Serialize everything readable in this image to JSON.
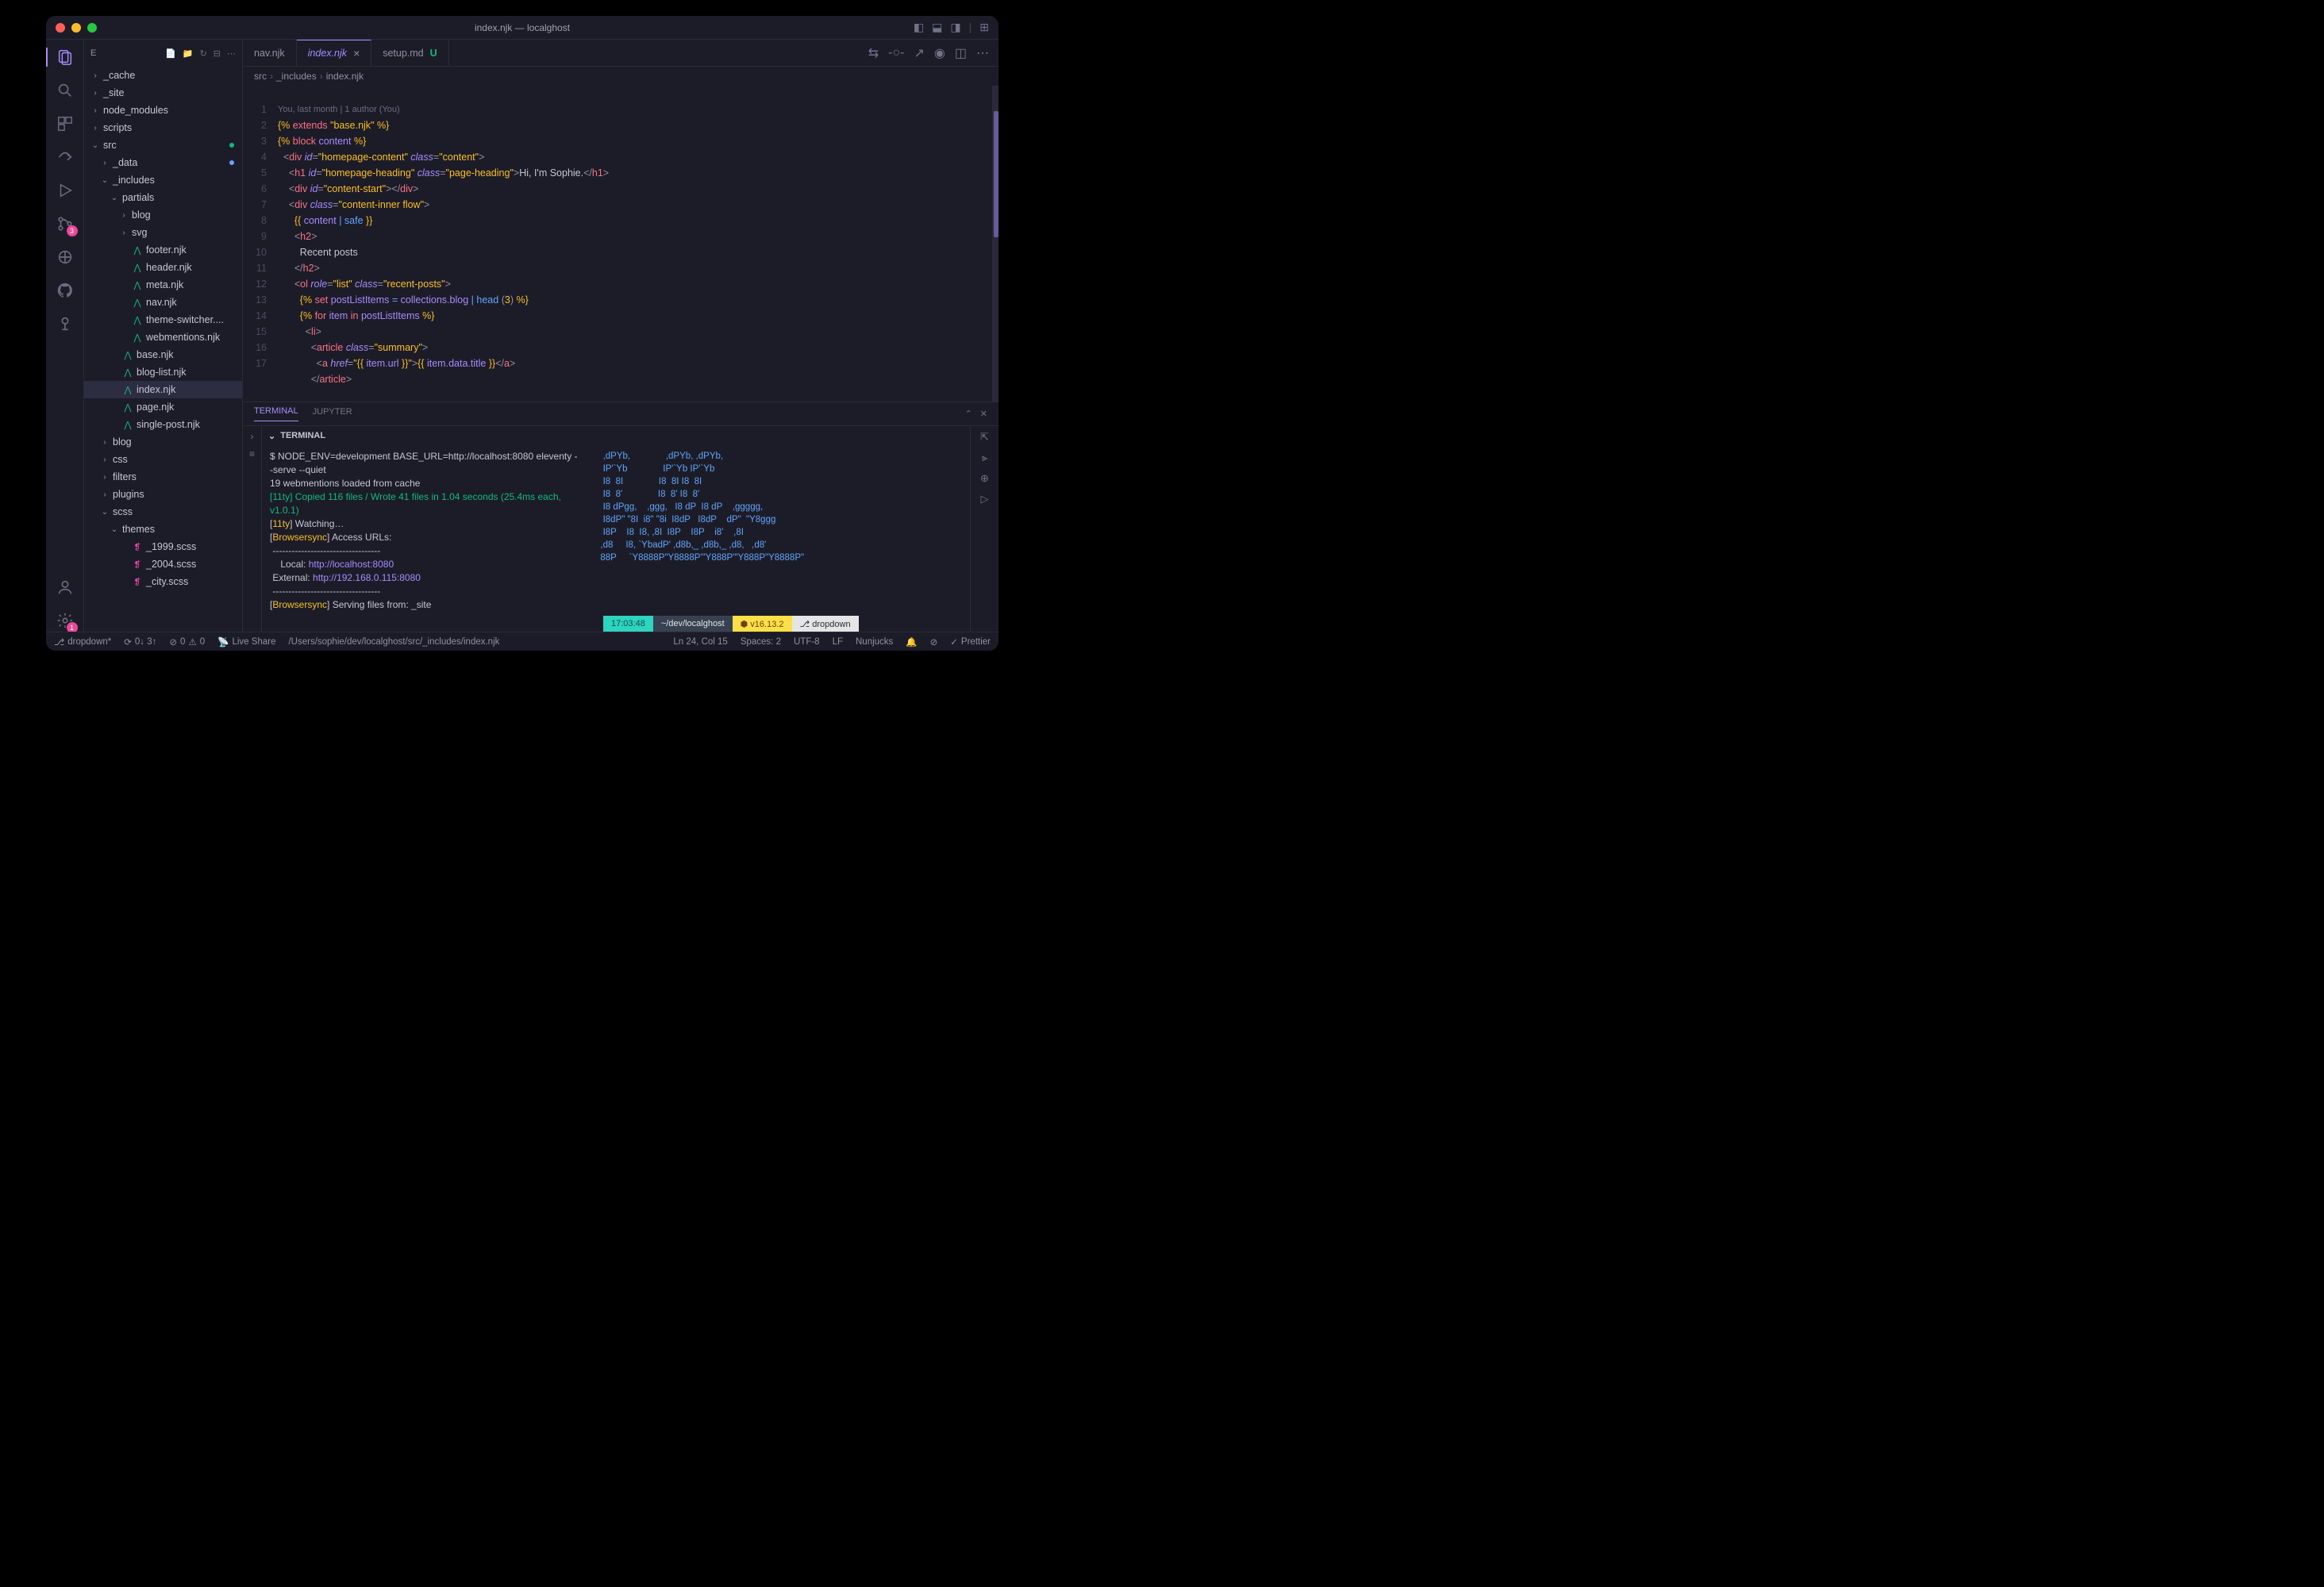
{
  "window_title": "index.njk — localghost",
  "explorer_label": "E",
  "activity": {
    "scm_badge": "3",
    "settings_badge": "1"
  },
  "tree": [
    {
      "d": 0,
      "exp": false,
      "icon": "chev-r",
      "label": "_cache"
    },
    {
      "d": 0,
      "exp": false,
      "icon": "chev-r",
      "label": "_site"
    },
    {
      "d": 0,
      "exp": false,
      "icon": "chev-r",
      "label": "node_modules"
    },
    {
      "d": 0,
      "exp": false,
      "icon": "chev-r",
      "label": "scripts"
    },
    {
      "d": 0,
      "exp": true,
      "icon": "chev-d",
      "label": "src",
      "dot": "g"
    },
    {
      "d": 1,
      "exp": false,
      "icon": "chev-r",
      "label": "_data",
      "dot": "b"
    },
    {
      "d": 1,
      "exp": true,
      "icon": "chev-d",
      "label": "_includes"
    },
    {
      "d": 2,
      "exp": true,
      "icon": "chev-d",
      "label": "partials"
    },
    {
      "d": 3,
      "exp": false,
      "icon": "chev-r",
      "label": "blog"
    },
    {
      "d": 3,
      "exp": false,
      "icon": "chev-r",
      "label": "svg"
    },
    {
      "d": 3,
      "file": "njk",
      "label": "footer.njk"
    },
    {
      "d": 3,
      "file": "njk",
      "label": "header.njk"
    },
    {
      "d": 3,
      "file": "njk",
      "label": "meta.njk"
    },
    {
      "d": 3,
      "file": "njk",
      "label": "nav.njk"
    },
    {
      "d": 3,
      "file": "njk",
      "label": "theme-switcher...."
    },
    {
      "d": 3,
      "file": "njk",
      "label": "webmentions.njk"
    },
    {
      "d": 2,
      "file": "njk",
      "label": "base.njk"
    },
    {
      "d": 2,
      "file": "njk",
      "label": "blog-list.njk"
    },
    {
      "d": 2,
      "file": "njk",
      "label": "index.njk",
      "sel": true
    },
    {
      "d": 2,
      "file": "njk",
      "label": "page.njk"
    },
    {
      "d": 2,
      "file": "njk",
      "label": "single-post.njk"
    },
    {
      "d": 1,
      "exp": false,
      "icon": "chev-r",
      "label": "blog"
    },
    {
      "d": 1,
      "exp": false,
      "icon": "chev-r",
      "label": "css"
    },
    {
      "d": 1,
      "exp": false,
      "icon": "chev-r",
      "label": "filters"
    },
    {
      "d": 1,
      "exp": false,
      "icon": "chev-r",
      "label": "plugins"
    },
    {
      "d": 1,
      "exp": true,
      "icon": "chev-d",
      "label": "scss"
    },
    {
      "d": 2,
      "exp": true,
      "icon": "chev-d",
      "label": "themes"
    },
    {
      "d": 3,
      "file": "scss",
      "label": "_1999.scss"
    },
    {
      "d": 3,
      "file": "scss",
      "label": "_2004.scss"
    },
    {
      "d": 3,
      "file": "scss",
      "label": "_city.scss"
    }
  ],
  "tabs": [
    {
      "label": "nav.njk",
      "active": false
    },
    {
      "label": "index.njk",
      "active": true,
      "close": true
    },
    {
      "label": "setup.md",
      "active": false,
      "status": "U"
    }
  ],
  "breadcrumb": [
    "src",
    "_includes",
    "index.njk"
  ],
  "codelens": "You, last month | 1 author (You)",
  "line_count": 17,
  "panel_tabs": [
    "TERMINAL",
    "JUPYTER"
  ],
  "panel_active": 0,
  "terminal_label": "TERMINAL",
  "term_left_lines": [
    {
      "t": "$ NODE_ENV=development BASE_URL=http://localhost:8080 eleventy --serve --quiet",
      "c": "tw"
    },
    {
      "t": "19 webmentions loaded from cache",
      "c": "tw"
    },
    {
      "t": "[11ty] Copied 116 files / Wrote 41 files in 1.04 seconds (25.4ms each, v1.0.1)",
      "c": "tg"
    },
    {
      "t": "[11ty] Watching…",
      "c": "tw",
      "pre": "[11ty]"
    },
    {
      "t": "[Browsersync] Access URLs:",
      "c": "tw",
      "pre": "[Browsersync]"
    },
    {
      "t": " ----------------------------------",
      "c": "tw"
    },
    {
      "t": "    Local: http://localhost:8080",
      "c": "",
      "lbl": "    Local: ",
      "url": "http://localhost:8080"
    },
    {
      "t": " External: http://192.168.0.115:8080",
      "c": "",
      "lbl": " External: ",
      "url": "http://192.168.0.115:8080"
    },
    {
      "t": " ----------------------------------",
      "c": "tw"
    },
    {
      "t": "[Browsersync] Serving files from: _site",
      "c": "tw",
      "pre": "[Browsersync]"
    }
  ],
  "term_ascii": "   ,dPYb,              ,dPYb, ,dPYb,\n   IP'`Yb              IP'`Yb IP'`Yb\n   I8  8I              I8  8I I8  8I\n   I8  8'              I8  8' I8  8'\n   I8 dPgg,    ,ggg,   I8 dP  I8 dP    ,ggggg,\n   I8dP\" \"8I  i8\" \"8i  I8dP   I8dP    dP\"  \"Y8ggg\n   I8P    I8  I8, ,8I  I8P    I8P    i8'    ,8I\n  ,d8     I8, `YbadP' ,d8b,_ ,d8b,_ ,d8,   ,d8'\n  88P     `Y8888P\"Y8888P'\"Y888P'\"Y888P\"Y8888P\"",
  "term_status": {
    "time": "17:03:48",
    "path": "~/dev/localghost",
    "node": "⬢ v16.13.2",
    "branch": "⎇ dropdown"
  },
  "status": {
    "branch": "dropdown*",
    "sync": "0↓ 3↑",
    "errors": "0",
    "warnings": "0",
    "liveshare": "Live Share",
    "path": "/Users/sophie/dev/localghost/src/_includes/index.njk",
    "cursor": "Ln 24, Col 15",
    "spaces": "Spaces: 2",
    "encoding": "UTF-8",
    "eol": "LF",
    "lang": "Nunjucks",
    "prettier": "Prettier"
  }
}
